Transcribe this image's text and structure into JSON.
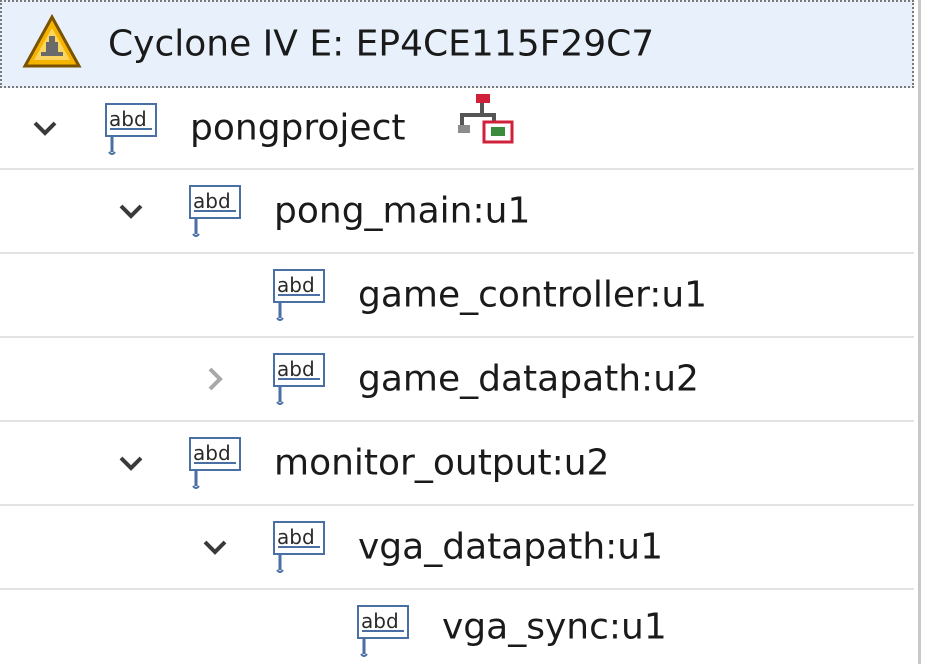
{
  "device": {
    "label": "Cyclone IV E: EP4CE115F29C7",
    "icon": "warning-triangle-icon"
  },
  "tree": {
    "nodes": [
      {
        "label": "pongproject",
        "icon": "abd-entity-icon",
        "expanded": true,
        "extra_icon": "hierarchy-icon"
      },
      {
        "label": "pong_main:u1",
        "icon": "abd-entity-icon",
        "expanded": true
      },
      {
        "label": "game_controller:u1",
        "icon": "abd-entity-icon",
        "expanded": null
      },
      {
        "label": "game_datapath:u2",
        "icon": "abd-entity-icon",
        "expanded": false
      },
      {
        "label": "monitor_output:u2",
        "icon": "abd-entity-icon",
        "expanded": true
      },
      {
        "label": "vga_datapath:u1",
        "icon": "abd-entity-icon",
        "expanded": true
      },
      {
        "label": "vga_sync:u1",
        "icon": "abd-entity-icon",
        "expanded": null
      }
    ]
  },
  "colors": {
    "selection_bg": "#e8f1fb",
    "row_divider": "#e3e3e3",
    "chevron": "#3a3a3a",
    "chevron_collapsed": "#a8a8a8",
    "warning": "#f2a900",
    "hier_red": "#d0203a",
    "hier_green": "#3c8a3c"
  }
}
